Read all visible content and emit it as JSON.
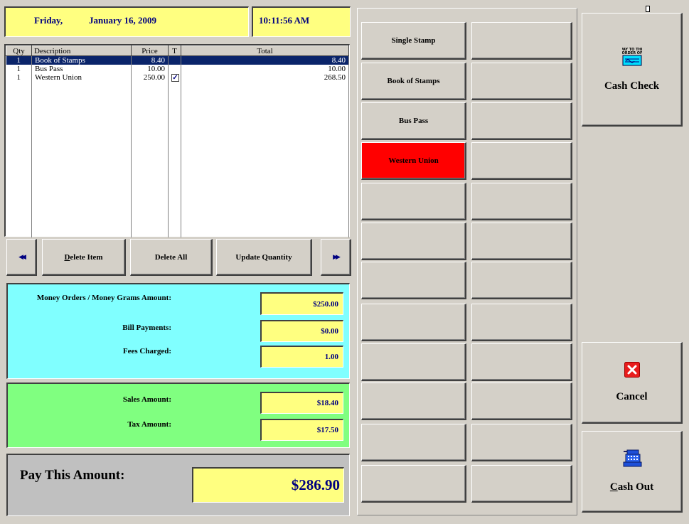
{
  "header": {
    "day": "Friday,",
    "date": "January 16, 2009",
    "time": "10:11:56 AM"
  },
  "grid": {
    "columns": [
      "Qty",
      "Description",
      "Price",
      "T",
      "Total"
    ],
    "rows": [
      {
        "qty": "1",
        "description": "Book of Stamps",
        "price": "8.40",
        "taxed": false,
        "total": "8.40",
        "selected": true
      },
      {
        "qty": "1",
        "description": "Bus Pass",
        "price": "10.00",
        "taxed": false,
        "total": "10.00",
        "selected": false
      },
      {
        "qty": "1",
        "description": "Western Union",
        "price": "250.00",
        "taxed": true,
        "total": "268.50",
        "selected": false
      }
    ]
  },
  "nav": {
    "prev_icon": "rewind-icon",
    "delete_item": "Delete Item",
    "delete_all": "Delete All",
    "update_quantity": "Update Quantity",
    "next_icon": "fast-forward-icon"
  },
  "money_panel": {
    "money_orders_label": "Money Orders / Money Grams Amount:",
    "money_orders_value": "$250.00",
    "bill_payments_label": "Bill Payments:",
    "bill_payments_value": "$0.00",
    "fees_label": "Fees Charged:",
    "fees_value": "1.00"
  },
  "sales_panel": {
    "sales_label": "Sales Amount:",
    "sales_value": "$18.40",
    "tax_label": "Tax Amount:",
    "tax_value": "$17.50"
  },
  "pay_panel": {
    "label": "Pay This Amount:",
    "value": "$286.90"
  },
  "products": {
    "left": [
      "Single Stamp",
      "Book of Stamps",
      "Bus Pass",
      "Western Union",
      "",
      "",
      "",
      "",
      "",
      "",
      "",
      ""
    ],
    "right": [
      "",
      "",
      "",
      "",
      "",
      "",
      "",
      "",
      "",
      "",
      "",
      ""
    ],
    "highlight_index": 3,
    "highlight_color": "#ff0000"
  },
  "actions": {
    "cash_check": "Cash Check",
    "cash_check_icon": "check-icon",
    "cancel": "Cancel",
    "cancel_icon": "red-x-icon",
    "cash_out": "Cash Out",
    "cash_out_icon": "cash-register-icon"
  },
  "colors": {
    "yellow": "#ffff80",
    "cyan": "#80ffff",
    "green": "#80ff80",
    "gray": "#c0c0c0",
    "selection": "#0a246a",
    "value_text": "#000080"
  }
}
